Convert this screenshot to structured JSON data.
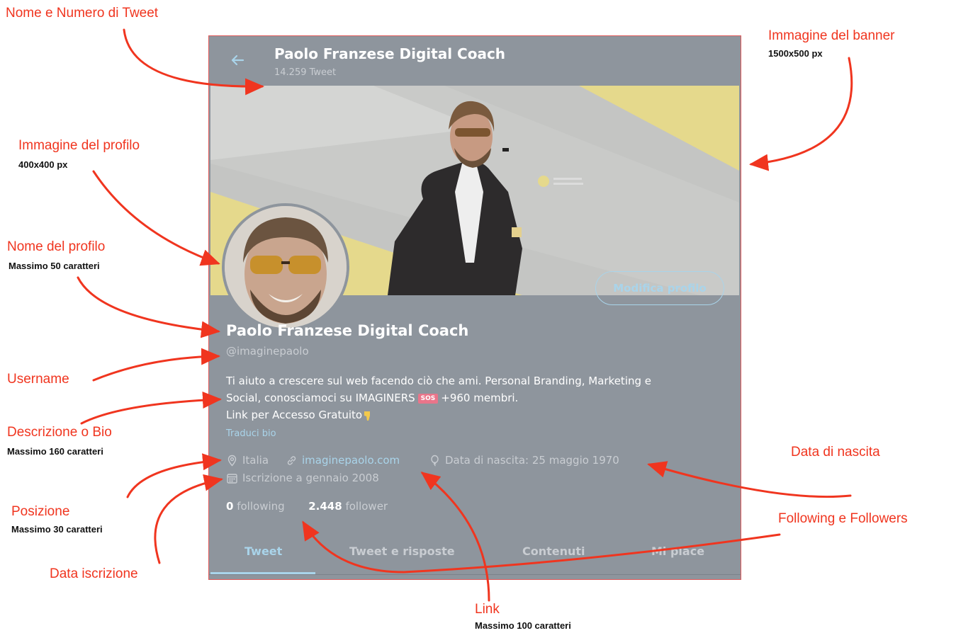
{
  "header": {
    "title": "Paolo Franzese Digital Coach",
    "tweet_count": "14.259 Tweet"
  },
  "profile": {
    "edit_button": "Modifica profilo",
    "name": "Paolo Franzese Digital Coach",
    "username": "@imaginepaolo",
    "bio_line1": "Ti aiuto a crescere sul web facendo ciò che ami. Personal Branding, Marketing e",
    "bio_line2_a": "Social, conosciamoci su IMAGINERS",
    "bio_badge": "SOS",
    "bio_line2_b": "+960 membri.",
    "bio_line3": "Link per Accesso Gratuito",
    "translate_bio": "Traduci bio",
    "location": "Italia",
    "link": "imaginepaolo.com",
    "birth": "Data di nascita: 25 maggio 1970",
    "joined": "Iscrizione a gennaio 2008",
    "following_count": "0",
    "following_label": "following",
    "followers_count": "2.448",
    "followers_label": "follower"
  },
  "tabs": [
    {
      "label": "Tweet"
    },
    {
      "label": "Tweet e risposte"
    },
    {
      "label": "Contenuti"
    },
    {
      "label": "Mi piace"
    }
  ],
  "annotations": {
    "name_tweets": "Nome e Numero di Tweet",
    "banner": "Immagine del banner",
    "banner_size": "1500x500 px",
    "profile_image": "Immagine del profilo",
    "profile_image_size": "400x400 px",
    "profile_name": "Nome del profilo",
    "profile_name_max": "Massimo 50 caratteri",
    "username": "Username",
    "bio": "Descrizione o Bio",
    "bio_max": "Massimo 160 caratteri",
    "position": "Posizione",
    "position_max": "Massimo 30 caratteri",
    "joined": "Data iscrizione",
    "birth": "Data di nascita",
    "follow": "Following e Followers",
    "link": "Link",
    "link_max": "Massimo 100 caratteri"
  },
  "colors": {
    "annotation": "#f0351f",
    "panel": "#8e959d",
    "accent": "#a9d4ea",
    "banner_yellow": "#e5d98c"
  }
}
